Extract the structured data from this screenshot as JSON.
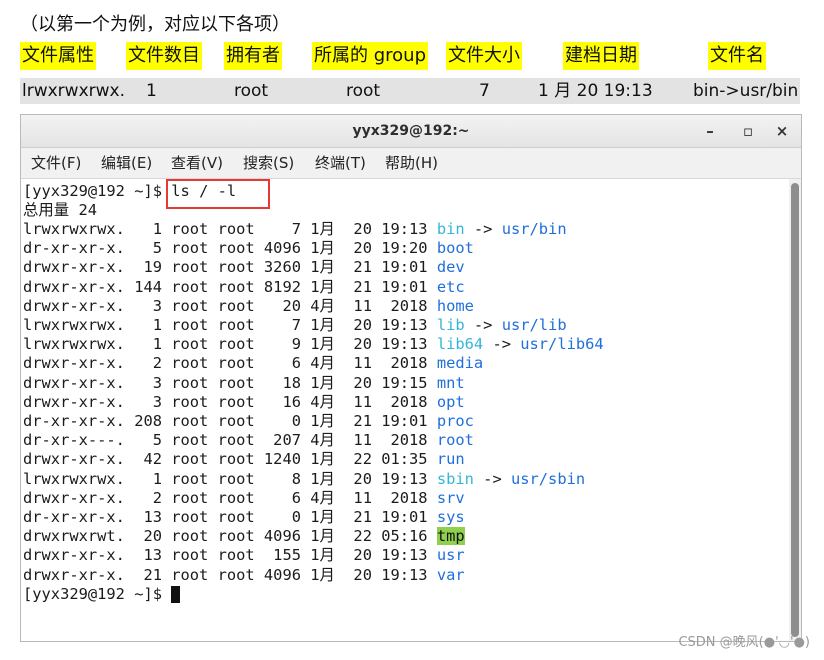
{
  "caption": "（以第一个为例，对应以下各项）",
  "headers": [
    "文件属性",
    "文件数目",
    "拥有者",
    "所属的 group",
    "文件大小",
    "建档日期",
    "文件名"
  ],
  "example": [
    "lrwxrwxrwx.",
    "1",
    "root",
    "root",
    "7",
    "1 月  20 19:13",
    "bin->usr/bin"
  ],
  "terminal": {
    "title": "yyx329@192:~",
    "buttons": {
      "minimize": "–",
      "maximize": "▫",
      "close": "×"
    },
    "menu": [
      "文件(F)",
      "编辑(E)",
      "查看(V)",
      "搜索(S)",
      "终端(T)",
      "帮助(H)"
    ],
    "prompt": "[yyx329@192 ~]$ ",
    "command": "ls / -l",
    "total": "总用量 24",
    "rows": [
      {
        "perm": "lrwxrwxrwx.",
        "links": "1",
        "owner": "root",
        "group": "root",
        "size": "7",
        "month": "1月",
        "day": "20",
        "time": "19:13",
        "name": "bin",
        "kind": "link",
        "target": "usr/bin"
      },
      {
        "perm": "dr-xr-xr-x.",
        "links": "5",
        "owner": "root",
        "group": "root",
        "size": "4096",
        "month": "1月",
        "day": "20",
        "time": "19:20",
        "name": "boot",
        "kind": "dir"
      },
      {
        "perm": "drwxr-xr-x.",
        "links": "19",
        "owner": "root",
        "group": "root",
        "size": "3260",
        "month": "1月",
        "day": "21",
        "time": "19:01",
        "name": "dev",
        "kind": "dir"
      },
      {
        "perm": "drwxr-xr-x.",
        "links": "144",
        "owner": "root",
        "group": "root",
        "size": "8192",
        "month": "1月",
        "day": "21",
        "time": "19:01",
        "name": "etc",
        "kind": "dir"
      },
      {
        "perm": "drwxr-xr-x.",
        "links": "3",
        "owner": "root",
        "group": "root",
        "size": "20",
        "month": "4月",
        "day": "11",
        "time": "2018",
        "name": "home",
        "kind": "dir"
      },
      {
        "perm": "lrwxrwxrwx.",
        "links": "1",
        "owner": "root",
        "group": "root",
        "size": "7",
        "month": "1月",
        "day": "20",
        "time": "19:13",
        "name": "lib",
        "kind": "link",
        "target": "usr/lib"
      },
      {
        "perm": "lrwxrwxrwx.",
        "links": "1",
        "owner": "root",
        "group": "root",
        "size": "9",
        "month": "1月",
        "day": "20",
        "time": "19:13",
        "name": "lib64",
        "kind": "link",
        "target": "usr/lib64"
      },
      {
        "perm": "drwxr-xr-x.",
        "links": "2",
        "owner": "root",
        "group": "root",
        "size": "6",
        "month": "4月",
        "day": "11",
        "time": "2018",
        "name": "media",
        "kind": "dir"
      },
      {
        "perm": "drwxr-xr-x.",
        "links": "3",
        "owner": "root",
        "group": "root",
        "size": "18",
        "month": "1月",
        "day": "20",
        "time": "19:15",
        "name": "mnt",
        "kind": "dir"
      },
      {
        "perm": "drwxr-xr-x.",
        "links": "3",
        "owner": "root",
        "group": "root",
        "size": "16",
        "month": "4月",
        "day": "11",
        "time": "2018",
        "name": "opt",
        "kind": "dir"
      },
      {
        "perm": "dr-xr-xr-x.",
        "links": "208",
        "owner": "root",
        "group": "root",
        "size": "0",
        "month": "1月",
        "day": "21",
        "time": "19:01",
        "name": "proc",
        "kind": "dir"
      },
      {
        "perm": "dr-xr-x---.",
        "links": "5",
        "owner": "root",
        "group": "root",
        "size": "207",
        "month": "4月",
        "day": "11",
        "time": "2018",
        "name": "root",
        "kind": "dir"
      },
      {
        "perm": "drwxr-xr-x.",
        "links": "42",
        "owner": "root",
        "group": "root",
        "size": "1240",
        "month": "1月",
        "day": "22",
        "time": "01:35",
        "name": "run",
        "kind": "dir"
      },
      {
        "perm": "lrwxrwxrwx.",
        "links": "1",
        "owner": "root",
        "group": "root",
        "size": "8",
        "month": "1月",
        "day": "20",
        "time": "19:13",
        "name": "sbin",
        "kind": "link",
        "target": "usr/sbin"
      },
      {
        "perm": "drwxr-xr-x.",
        "links": "2",
        "owner": "root",
        "group": "root",
        "size": "6",
        "month": "4月",
        "day": "11",
        "time": "2018",
        "name": "srv",
        "kind": "dir"
      },
      {
        "perm": "dr-xr-xr-x.",
        "links": "13",
        "owner": "root",
        "group": "root",
        "size": "0",
        "month": "1月",
        "day": "21",
        "time": "19:01",
        "name": "sys",
        "kind": "dir"
      },
      {
        "perm": "drwxrwxrwt.",
        "links": "20",
        "owner": "root",
        "group": "root",
        "size": "4096",
        "month": "1月",
        "day": "22",
        "time": "05:16",
        "name": "tmp",
        "kind": "sticky"
      },
      {
        "perm": "drwxr-xr-x.",
        "links": "13",
        "owner": "root",
        "group": "root",
        "size": "155",
        "month": "1月",
        "day": "20",
        "time": "19:13",
        "name": "usr",
        "kind": "dir"
      },
      {
        "perm": "drwxr-xr-x.",
        "links": "21",
        "owner": "root",
        "group": "root",
        "size": "4096",
        "month": "1月",
        "day": "20",
        "time": "19:13",
        "name": "var",
        "kind": "dir"
      }
    ],
    "link_arrow": " -> "
  },
  "watermark": "CSDN @晚风(●'◡'●)",
  "colors": {
    "highlight": "#ffff00",
    "link_name": "#35b6d8",
    "dir_name": "#1f6fdc",
    "tmp_bg": "#8fd14f",
    "command_box": "#e53935"
  }
}
